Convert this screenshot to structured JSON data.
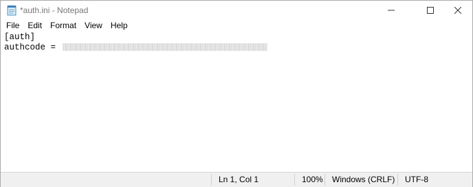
{
  "window": {
    "title": "*auth.ini - Notepad",
    "app_icon": "notepad-icon",
    "controls": [
      "minimize-icon",
      "maximize-icon",
      "close-icon"
    ]
  },
  "menu": {
    "items": [
      "File",
      "Edit",
      "Format",
      "View",
      "Help"
    ]
  },
  "editor": {
    "lines": [
      {
        "text": "[auth]"
      },
      {
        "text": "authcode = ",
        "redacted": true
      }
    ]
  },
  "status": {
    "position": "Ln 1, Col 1",
    "zoom": "100%",
    "line_ending": "Windows (CRLF)",
    "encoding": "UTF-8"
  }
}
